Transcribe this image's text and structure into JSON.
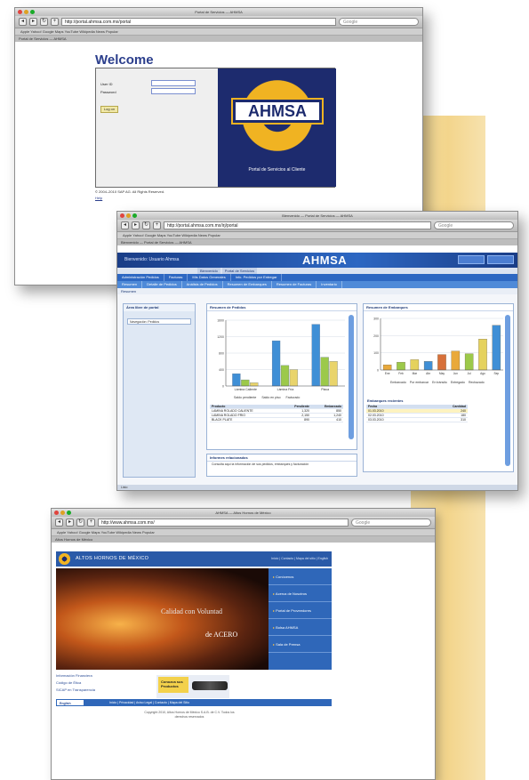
{
  "window1": {
    "title": "Portal de Servicios — AHMSA",
    "url": "http://portal.ahmsa.com.mx/portal",
    "search_placeholder": "Google",
    "bookmarks": "Apple  Yahoo!  Google Maps  YouTube  Wikipedia  News  Popular",
    "tab": "Portal de Servicios — AHMSA",
    "welcome": "Welcome",
    "user_id_label": "User ID",
    "password_label": "Password",
    "enter_button": "Log on",
    "logo_text": "AHMSA",
    "portal_caption": "Portal de Servicios al Cliente",
    "footnote": "© 2004–2010 SAP AG. All Rights Reserved.",
    "footer_link": "Help"
  },
  "window2": {
    "title": "Bienvenido — Portal de Servicios — AHMSA",
    "url": "http://portal.ahmsa.com.mx/irj/portal",
    "search_placeholder": "Google",
    "banner_text": "Bienvenido: Usuario Ahmsa",
    "logo_text": "AHMSA",
    "tabs_top": [
      "Bienvenido",
      "Portal de Servicios"
    ],
    "tabs_main": [
      "Administración Pedidos",
      "Facturas",
      "Mis Datos Generales",
      "Info. Pedidos por Entregar"
    ],
    "tabs_sub": [
      "Resumen",
      "Detalle de Pedidos",
      "Análisis de Pedidos",
      "Resumen de Embarques",
      "Resumen de Facturas",
      "Inventario"
    ],
    "path": "Resumen",
    "side_title": "Área libre de portal",
    "side_item": "Navegación: Pedidos",
    "panel_left": {
      "title": "Resumen de Pedidos",
      "legend": [
        "Saldo pendiente",
        "Saldo en piso",
        "Facturado"
      ],
      "table_head": [
        "Producto",
        "Pendiente",
        "Embarcado"
      ],
      "rows": [
        [
          "LAMINA ROLADO CALIENTE",
          "1,320",
          "850"
        ],
        [
          "LAMINA ROLADO FRIO",
          "2,150",
          "1,240"
        ],
        [
          "BLACK PLATE",
          "890",
          "410"
        ]
      ],
      "info_title": "Informes relacionados",
      "info_text": "Consulta aquí la información de sus pedidos, embarques y facturación"
    },
    "panel_right": {
      "title": "Resumen de Embarques",
      "legend": [
        "Embarcado",
        "Por embarcar",
        "En tránsito",
        "Entregado",
        "Rechazado"
      ],
      "table_title": "Embarques recientes",
      "table_head": [
        "Fecha",
        "Cantidad"
      ],
      "rows": [
        [
          "01.03.2010",
          "240"
        ],
        [
          "02.03.2010",
          "180"
        ],
        [
          "03.03.2010",
          "310"
        ]
      ]
    },
    "status": "Listo"
  },
  "window3": {
    "title": "AHMSA — Altos Hornos de México",
    "url": "http://www.ahmsa.com.mx/",
    "search_placeholder": "Google",
    "bookmarks": "Apple  Yahoo!  Google Maps  YouTube  Wikipedia  News  Popular",
    "tab": "Altos Hornos de México",
    "brand": "ALTOS HORNOS DE MÉXICO",
    "top_links": "Inicio | Contacto | Mapa del sitio | English",
    "hero_line1": "Calidad con Voluntad",
    "hero_line2": "de ACERO",
    "menu": [
      "Conócenos",
      "Acerca de Nosotros",
      "Portal de Proveedores",
      "Bolsa AHMSA",
      "Sala de Prensa"
    ],
    "side_links": [
      "Información Financiera",
      "Código de Ética",
      "SICAP en Transparencia"
    ],
    "ad_text": "Conozca sus Productos",
    "language": "English",
    "footer_links": "Inicio | Privacidad | Aviso Legal | Contacto | Mapa del Sitio",
    "copyright": "Copyright 2010, Altos Hornos de México S.A.B. de C.V. Todos los derechos reservados",
    "colors": {
      "brand_blue": "#2a5aa8",
      "accent_yellow": "#f0b322"
    }
  },
  "chart_left": {
    "type": "bar",
    "categories": [
      "Lámina Caliente",
      "Lámina Fría",
      "Placa"
    ],
    "series": [
      {
        "name": "Saldo pendiente",
        "values": [
          300,
          1100,
          1500
        ]
      },
      {
        "name": "Saldo en piso",
        "values": [
          150,
          500,
          700
        ]
      },
      {
        "name": "Facturado",
        "values": [
          80,
          400,
          600
        ]
      }
    ],
    "ylim": [
      0,
      1600
    ]
  },
  "chart_right": {
    "type": "bar",
    "categories": [
      "Ene",
      "Feb",
      "Mar",
      "Abr",
      "May",
      "Jun",
      "Jul",
      "Ago",
      "Sep"
    ],
    "values": [
      30,
      45,
      60,
      50,
      90,
      110,
      95,
      180,
      260
    ],
    "ylim": [
      0,
      300
    ]
  }
}
